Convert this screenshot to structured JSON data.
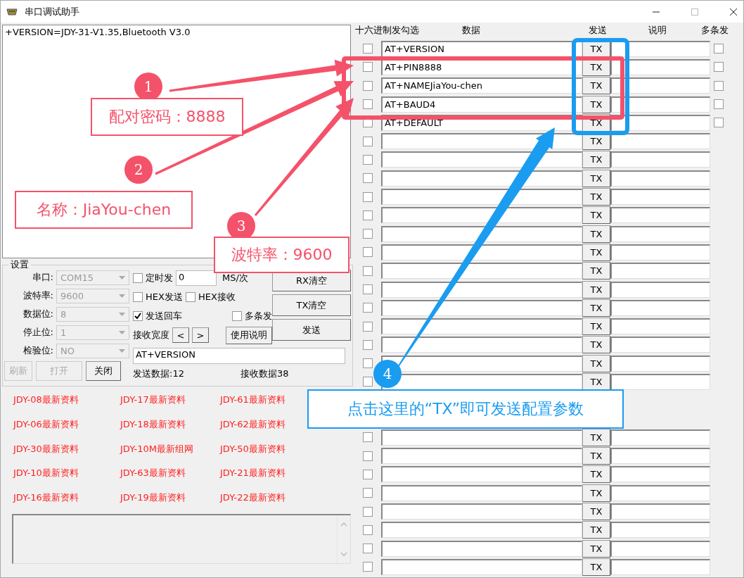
{
  "window": {
    "title": "串口调试助手"
  },
  "receive_text": "+VERSION=JDY-31-V1.35,Bluetooth V3.0",
  "settings": {
    "title": "设置",
    "fields": [
      {
        "label": "串口:",
        "value": "COM15",
        "disabled": true
      },
      {
        "label": "波特率:",
        "value": "9600",
        "disabled": true
      },
      {
        "label": "数据位:",
        "value": "8",
        "disabled": true
      },
      {
        "label": "停止位:",
        "value": "1",
        "disabled": true
      },
      {
        "label": "检验位:",
        "value": "NO",
        "disabled": true
      }
    ],
    "port_buttons": [
      {
        "label": "刷新",
        "disabled": true
      },
      {
        "label": "打开",
        "disabled": true
      },
      {
        "label": "关闭",
        "disabled": false
      }
    ],
    "timed_send": {
      "label": "定时发",
      "checked": false,
      "interval": "0",
      "unit": "MS/次"
    },
    "options": [
      {
        "label": "HEX发送",
        "checked": false
      },
      {
        "label": "HEX接收",
        "checked": false
      },
      {
        "label": "发送回车",
        "checked": true
      },
      {
        "label": "多条发",
        "checked": false
      }
    ],
    "width_label": "接收宽度",
    "width_buttons": [
      "<",
      ">"
    ],
    "help_button": "使用说明",
    "action_buttons": [
      "RX清空",
      "TX清空",
      "发送"
    ],
    "send_input": "AT+VERSION",
    "sent_count": "发送数据:12",
    "received_count": "接收数据38"
  },
  "links": [
    "JDY-08最新资料",
    "JDY-17最新资料",
    "JDY-61最新资料",
    "JDY-06最新资料",
    "JDY-18最新资料",
    "JDY-62最新资料",
    "JDY-30最新资料",
    "JDY-10M最新组网",
    "JDY-50最新资料",
    "JDY-10最新资料",
    "JDY-63最新资料",
    "JDY-21最新资料",
    "JDY-16最新资料",
    "JDY-19最新资料",
    "JDY-22最新资料"
  ],
  "multi_send": {
    "columns": [
      "十六进制发勾选",
      "数据",
      "发送",
      "说明",
      "多条发"
    ],
    "rows": [
      {
        "hex": false,
        "data": "AT+VERSION",
        "button": "TX",
        "multi": false
      },
      {
        "hex": false,
        "data": "AT+PIN8888",
        "button": "TX",
        "multi": false
      },
      {
        "hex": false,
        "data": "AT+NAMEJiaYou-chen",
        "button": "TX",
        "multi": false
      },
      {
        "hex": false,
        "data": "AT+BAUD4",
        "button": "TX",
        "multi": false
      },
      {
        "hex": false,
        "data": "AT+DEFAULT",
        "button": "TX",
        "multi": false
      },
      {
        "hex": false,
        "button": "TX"
      },
      {
        "hex": false,
        "button": "TX"
      },
      {
        "hex": false,
        "button": "TX"
      },
      {
        "hex": false,
        "button": "TX"
      },
      {
        "hex": false,
        "button": "TX"
      },
      {
        "hex": false,
        "button": "TX"
      },
      {
        "hex": false,
        "button": "TX"
      },
      {
        "hex": false,
        "button": "TX"
      },
      {
        "hex": false,
        "button": "TX"
      },
      {
        "hex": false,
        "button": "TX"
      },
      {
        "hex": false,
        "button": "TX"
      },
      {
        "hex": false,
        "button": "TX"
      },
      {
        "hex": false,
        "button": "TX"
      },
      {
        "hex": false,
        "button": "TX"
      }
    ],
    "rows_below_callout": [
      {
        "hex": false,
        "button": "TX"
      },
      {
        "hex": false,
        "button": "TX"
      },
      {
        "hex": false,
        "button": "TX"
      },
      {
        "hex": false,
        "button": "TX"
      },
      {
        "hex": false,
        "button": "TX"
      },
      {
        "hex": false,
        "button": "TX"
      },
      {
        "hex": false,
        "button": "TX"
      },
      {
        "hex": false,
        "button": "TX"
      }
    ]
  },
  "annotations": [
    {
      "number": "1",
      "text": "配对密码：8888",
      "color": "#f4526a"
    },
    {
      "number": "2",
      "text": "名称：JiaYou-chen",
      "color": "#f4526a"
    },
    {
      "number": "3",
      "text": "波特率：9600",
      "color": "#f4526a"
    },
    {
      "number": "4",
      "text": "点击这里的“TX”即可发送配置参数",
      "color": "#1a9cf0"
    }
  ]
}
